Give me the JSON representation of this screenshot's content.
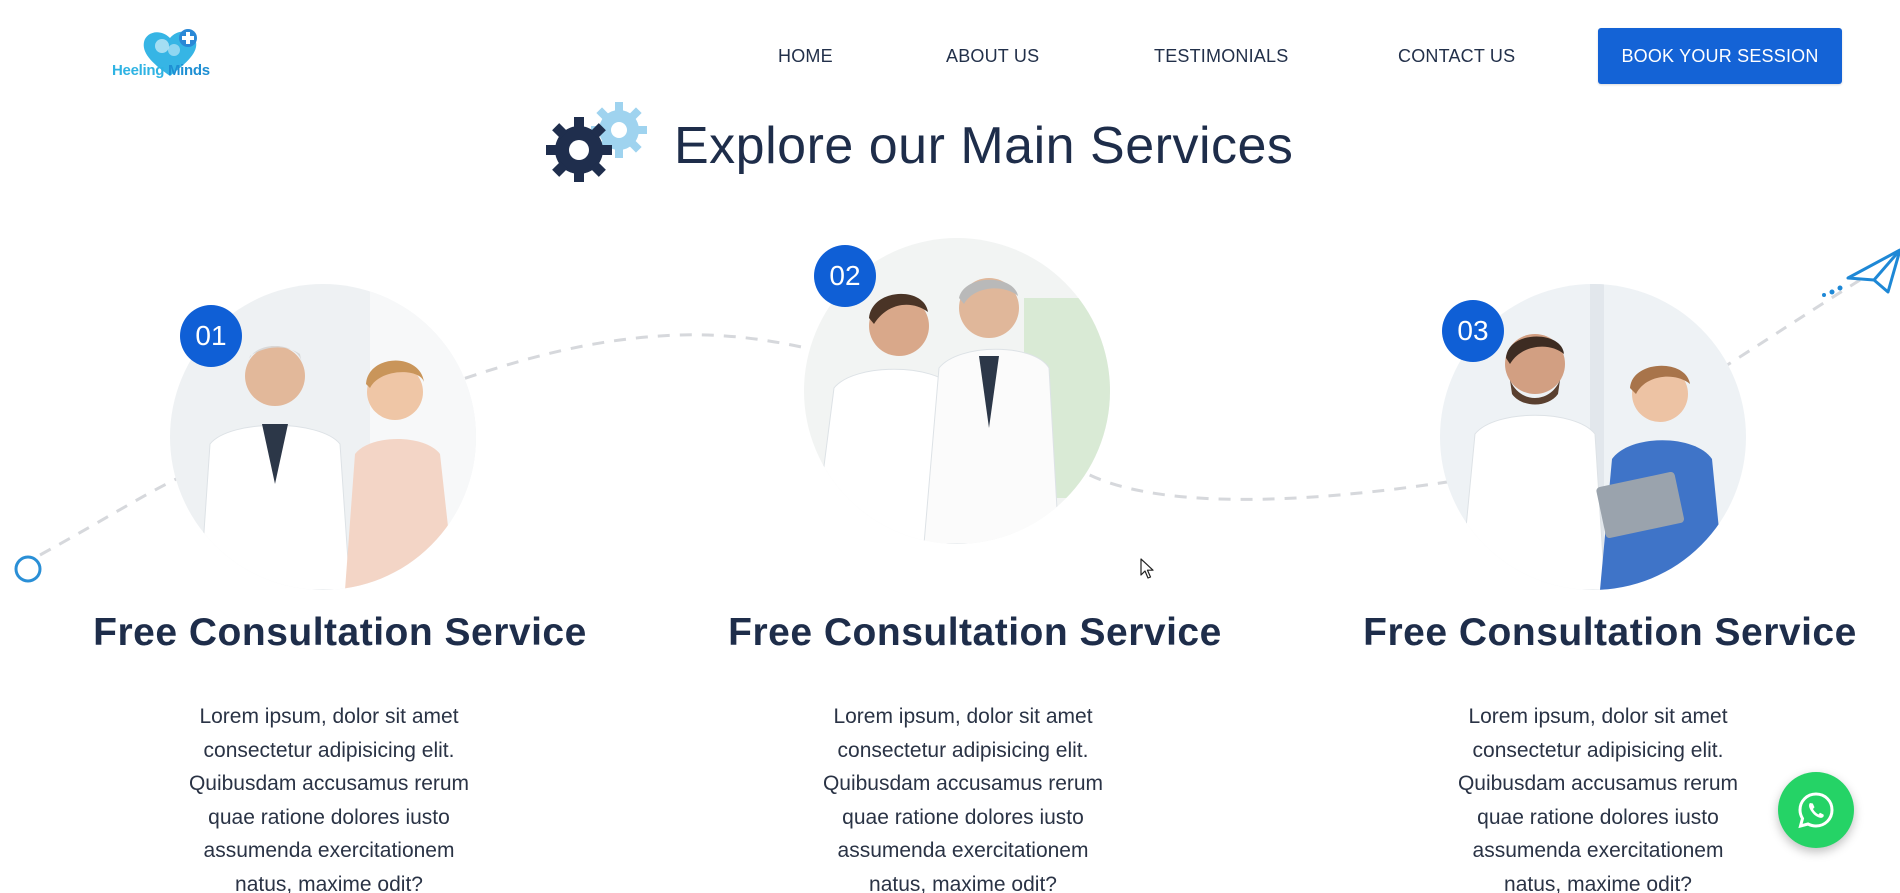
{
  "header": {
    "logo": {
      "word1": "Heeling",
      "word2": "Minds"
    },
    "nav": [
      {
        "label": "HOME"
      },
      {
        "label": "ABOUT US"
      },
      {
        "label": "TESTIMONIALS"
      },
      {
        "label": "CONTACT US"
      }
    ],
    "cta_label": "BOOK YOUR SESSION"
  },
  "section": {
    "title": "Explore our Main Services",
    "icon": "gears-icon"
  },
  "services": [
    {
      "number": "01",
      "title": "Free Consultation Service",
      "line1": "Lorem ipsum, dolor sit amet",
      "line2": "consectetur adipisicing elit.",
      "line3": "Quibusdam accusamus rerum",
      "line4": "quae ratione dolores iusto",
      "line5": "assumenda exercitationem",
      "line6": "natus, maxime odit?"
    },
    {
      "number": "02",
      "title": "Free Consultation Service",
      "line1": "Lorem ipsum, dolor sit amet",
      "line2": "consectetur adipisicing elit.",
      "line3": "Quibusdam accusamus rerum",
      "line4": "quae ratione dolores iusto",
      "line5": "assumenda exercitationem",
      "line6": "natus, maxime odit?"
    },
    {
      "number": "03",
      "title": "Free Consultation Service",
      "line1": "Lorem ipsum, dolor sit amet",
      "line2": "consectetur adipisicing elit.",
      "line3": "Quibusdam accusamus rerum",
      "line4": "quae ratione dolores iusto",
      "line5": "assumenda exercitationem",
      "line6": "natus, maxime odit?"
    }
  ],
  "colors": {
    "primary": "#1463d6",
    "badge": "#0f5fd6",
    "heading": "#1e2d4a",
    "logo_light": "#2fb3e3",
    "whatsapp": "#25d366"
  },
  "icons": [
    "gears-icon",
    "paper-plane-icon",
    "whatsapp-icon",
    "heart-brain-logo-icon",
    "path-start-circle-icon"
  ]
}
